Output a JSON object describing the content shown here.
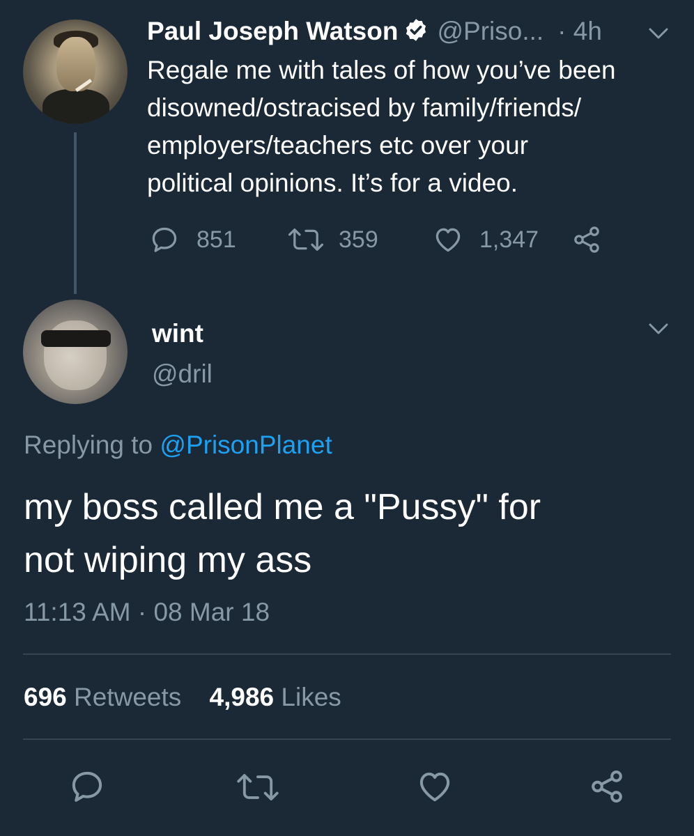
{
  "parent_tweet": {
    "author_name": "Paul Joseph Watson",
    "handle": "@Priso...",
    "time": "· 4h",
    "text": "Regale me with tales of how you’ve been\ndisowned/ostracised by family/friends/\nemployers/teachers etc over your\npolitical opinions. It’s for a video.",
    "replies": "851",
    "retweets": "359",
    "likes": "1,347"
  },
  "reply_tweet": {
    "author_name": "wint",
    "handle": "@dril",
    "replying_label": "Replying to",
    "replying_handle": "@PrisonPlanet",
    "text": "my boss called me a \"Pussy\" for\nnot wiping my ass",
    "timestamp": "11:13 AM · 08 Mar 18",
    "retweet_count": "696",
    "retweet_label": "Retweets",
    "like_count": "4,986",
    "like_label": "Likes"
  },
  "colors": {
    "background": "#1b2836",
    "text": "#ffffff",
    "secondary": "#8899a6",
    "accent": "#1da1f2",
    "divider": "#38444d"
  },
  "icons": [
    "verified-badge-icon",
    "chevron-down-icon",
    "reply-icon",
    "retweet-icon",
    "like-icon",
    "share-icon"
  ]
}
